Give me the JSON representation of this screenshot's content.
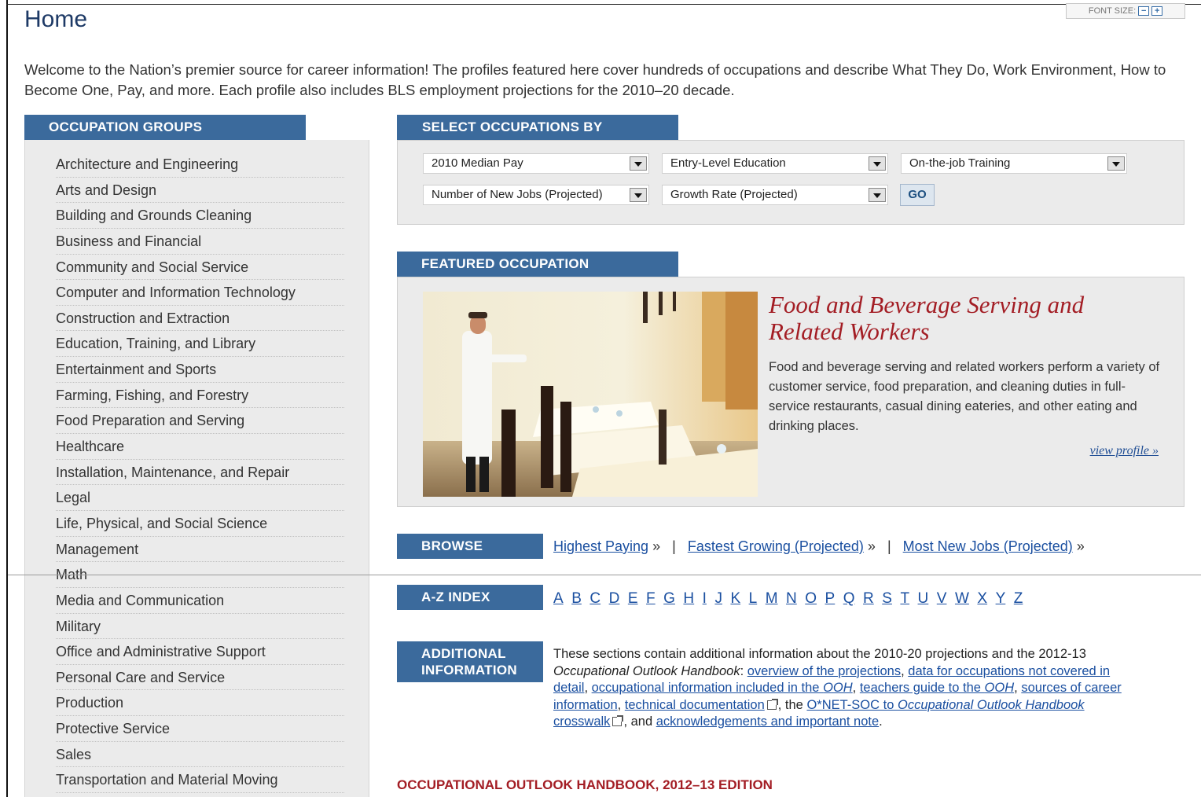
{
  "font_size": {
    "label": "FONT SIZE:",
    "decrease": "−",
    "increase": "+"
  },
  "page": {
    "title": "Home",
    "intro": "Welcome to the Nation’s premier source for career information! The profiles featured here cover hundreds of occupations and describe What They Do, Work Environment, How to Become One, Pay, and more. Each profile also includes BLS employment projections for the 2010–20 decade."
  },
  "occupation_groups": {
    "heading": "OCCUPATION GROUPS",
    "items": [
      "Architecture and Engineering",
      "Arts and Design",
      "Building and Grounds Cleaning",
      "Business and Financial",
      "Community and Social Service",
      "Computer and Information Technology",
      "Construction and Extraction",
      "Education, Training, and Library",
      "Entertainment and Sports",
      "Farming, Fishing, and Forestry",
      "Food Preparation and Serving",
      "Healthcare",
      "Installation, Maintenance, and Repair",
      "Legal",
      "Life, Physical, and Social Science",
      "Management",
      "Math",
      "Media and Communication",
      "Military",
      "Office and Administrative Support",
      "Personal Care and Service",
      "Production",
      "Protective Service",
      "Sales",
      "Transportation and Material Moving"
    ]
  },
  "select_by": {
    "heading": "SELECT OCCUPATIONS BY",
    "dropdowns": [
      "2010 Median Pay",
      "Entry-Level Education",
      "On-the-job Training",
      "Number of New Jobs (Projected)",
      "Growth Rate (Projected)"
    ],
    "go_label": "GO"
  },
  "featured": {
    "heading": "FEATURED OCCUPATION",
    "title": "Food and Beverage Serving and Related Workers",
    "description": "Food and beverage serving and related workers perform a variety of customer service, food preparation, and cleaning duties in full-service restaurants, casual dining eateries, and other eating and drinking places.",
    "view_profile": "view profile »"
  },
  "browse": {
    "heading": "BROWSE",
    "links": [
      "Highest Paying",
      "Fastest Growing (Projected)",
      "Most New Jobs (Projected)"
    ],
    "arrow": "»",
    "separator": "|"
  },
  "az_index": {
    "heading": "A-Z INDEX",
    "letters": [
      "A",
      "B",
      "C",
      "D",
      "E",
      "F",
      "G",
      "H",
      "I",
      "J",
      "K",
      "L",
      "M",
      "N",
      "O",
      "P",
      "Q",
      "R",
      "S",
      "T",
      "U",
      "V",
      "W",
      "X",
      "Y",
      "Z"
    ]
  },
  "additional": {
    "heading_line1": "ADDITIONAL",
    "heading_line2": "INFORMATION",
    "t1": "These sections contain additional information about the 2010-20 projections and the 2012-13 ",
    "t1_italic": "Occupational Outlook Handbook",
    "t2": ": ",
    "l1": "overview of the projections",
    "c1": ", ",
    "l2": "data for occupations not covered in detail",
    "c2": ", ",
    "l3a": "occupational information included in the ",
    "l3b": "OOH",
    "c3": ", ",
    "l4a": "teachers guide to the ",
    "l4b": "OOH",
    "c4": ", ",
    "l5": "sources of career information",
    "c5": ", ",
    "l6": "technical documentation",
    "c6": ", the ",
    "l7a": "O*NET-SOC to ",
    "l7b": "Occupational Outlook Handbook",
    "l7c": " crosswalk",
    "c7": ", and ",
    "l8": "acknowledgements and important note",
    "c8": "."
  },
  "edition": "OCCUPATIONAL OUTLOOK HANDBOOK, 2012–13 EDITION",
  "colors": {
    "section_blue": "#3b6a9c",
    "title_red": "#a31d24",
    "link_blue": "#1a4fa0"
  }
}
